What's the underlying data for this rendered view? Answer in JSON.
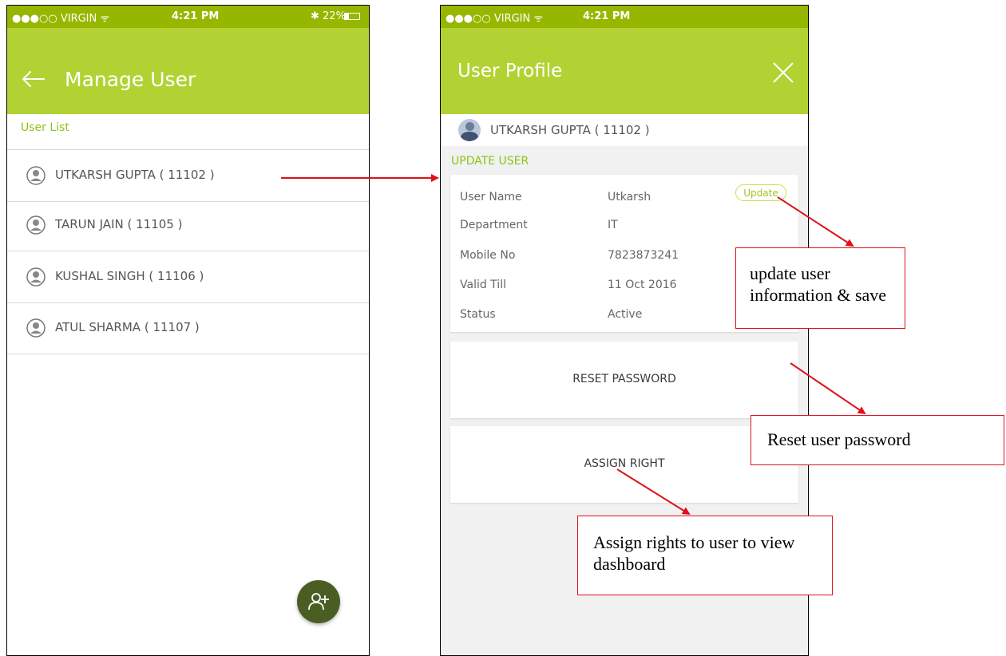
{
  "left_screen": {
    "status": {
      "carrier": "●●●○○ VIRGIN ᯤ",
      "time": "4:21 PM",
      "battery": "✱ 22%"
    },
    "header": {
      "title": "Manage User",
      "back_icon": "arrow-left-icon"
    },
    "section_label": "User List",
    "users": [
      {
        "name": "UTKARSH  GUPTA ( 11102 )"
      },
      {
        "name": "TARUN JAIN ( 11105 )"
      },
      {
        "name": "KUSHAL SINGH ( 11106 )"
      },
      {
        "name": "ATUL SHARMA ( 11107 )"
      }
    ],
    "fab_icon": "add-user-icon"
  },
  "right_screen": {
    "status": {
      "carrier": "●●●○○ VIRGIN ᯤ",
      "time": "4:21 PM"
    },
    "header": {
      "title": "User Profile",
      "close_icon": "close-icon"
    },
    "profile_name": "UTKARSH  GUPTA ( 11102 )",
    "update_section_label": "UPDATE USER",
    "update_button": "Update",
    "fields": [
      {
        "label": "User Name",
        "value": "Utkarsh"
      },
      {
        "label": "Department",
        "value": "IT"
      },
      {
        "label": "Mobile No",
        "value": "7823873241"
      },
      {
        "label": "Valid Till",
        "value": "11 Oct 2016"
      },
      {
        "label": "Status",
        "value": "Active"
      }
    ],
    "reset_password": "RESET PASSWORD",
    "assign_right": "ASSIGN RIGHT"
  },
  "annotations": {
    "update_note": "update user information & save",
    "reset_note": "Reset user password",
    "assign_note": "Assign rights to user to view dashboard"
  },
  "colors": {
    "header_green": "#b2d234",
    "status_green": "#95b700",
    "label_green": "#8fc21a",
    "fab_dark": "#4a5e23",
    "annotation_red": "#e0101a"
  }
}
